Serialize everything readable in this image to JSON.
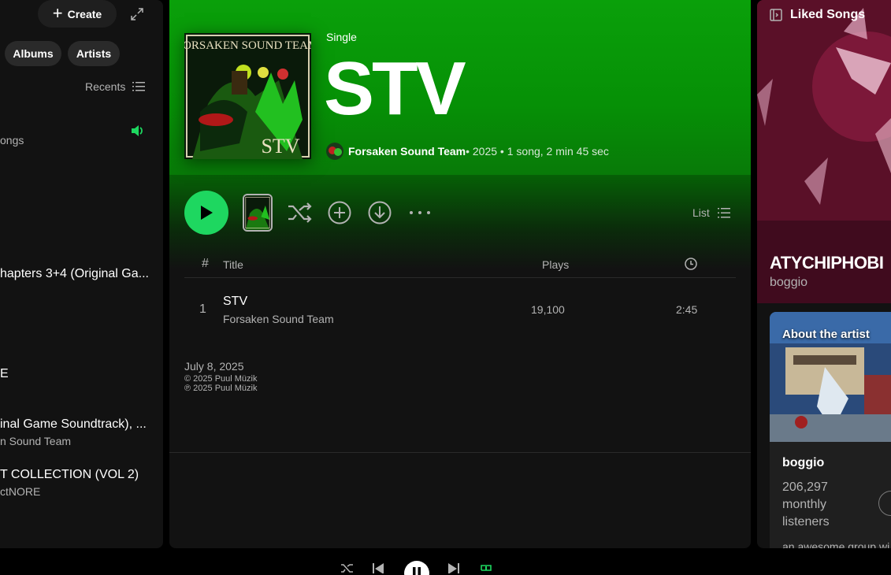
{
  "sidebar": {
    "create_label": "Create",
    "filters": [
      "Albums",
      "Artists"
    ],
    "sort_label": "Recents",
    "items": [
      {
        "title": "",
        "sub": "ongs"
      },
      {
        "title": "hapters 3+4 (Original Ga...",
        "sub": ""
      },
      {
        "title": "E",
        "sub": ""
      },
      {
        "title": "inal Game Soundtrack), ...",
        "sub": "n Sound Team"
      },
      {
        "title": "T COLLECTION (VOL 2)",
        "sub": "ctNORE"
      }
    ]
  },
  "album": {
    "type": "Single",
    "title": "STV",
    "artist": "Forsaken Sound Team",
    "details": " • 2025 • 1 song, 2 min 45 sec",
    "cover_text_top": "FORSAKEN SOUND TEAM",
    "cover_text_bottom": "STV",
    "colors": {
      "header": "#0aa00a",
      "play": "#1ed760"
    }
  },
  "actions": {
    "list_label": "List"
  },
  "tracklist": {
    "headers": {
      "num": "#",
      "title": "Title",
      "plays": "Plays"
    },
    "rows": [
      {
        "num": "1",
        "title": "STV",
        "artist": "Forsaken Sound Team",
        "plays": "19,100",
        "duration": "2:45"
      }
    ]
  },
  "release": {
    "date": "July 8, 2025",
    "copyright": "© 2025 Puul Müzik",
    "phonographic": "℗ 2025 Puul Müzik"
  },
  "right_panel": {
    "header": "Liked Songs",
    "now_playing_title": "ATYCHIPHOBI",
    "now_playing_artist": "boggio",
    "about_label": "About the artist",
    "artist_name": "boggio",
    "listeners": "206,297 monthly listeners",
    "description": "an awesome group wi"
  },
  "icons": [
    "plus-icon",
    "expand-icon",
    "list-icon",
    "speaker-icon",
    "play-icon",
    "shuffle-icon",
    "add-circle-icon",
    "download-icon",
    "more-icon",
    "clock-icon",
    "panel-icon",
    "pause-icon",
    "previous-icon",
    "next-icon",
    "repeat-icon"
  ]
}
